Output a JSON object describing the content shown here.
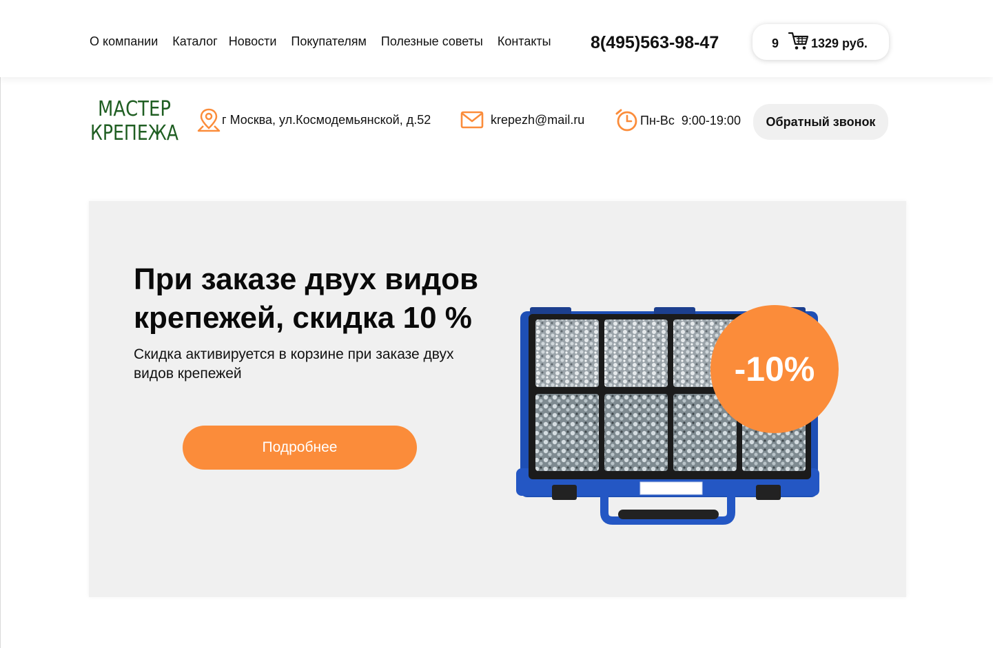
{
  "nav": {
    "items": [
      {
        "label": "О компании"
      },
      {
        "label": "Каталог"
      },
      {
        "label": "Новости"
      },
      {
        "label": "Покупателям"
      },
      {
        "label": "Полезные советы"
      },
      {
        "label": "Контакты"
      }
    ]
  },
  "header": {
    "phone": "8(495)563-98-47",
    "cart": {
      "count": "9",
      "total": "1329 руб."
    }
  },
  "logo": {
    "line1": "МАСТЕР",
    "line2": "КРЕПЕЖА"
  },
  "contacts": {
    "address": "г Москва, ул.Космодемьянской, д.52",
    "email": "krepezh@mail.ru",
    "hours": "Пн-Вс  9:00-19:00",
    "callback_label": "Обратный звонок"
  },
  "promo": {
    "title": "При заказе двух видов крепежей, скидка 10 %",
    "subtitle": "Скидка активируется в корзине при заказе двух видов крепежей",
    "button_label": "Подробнее",
    "badge": "-10%"
  },
  "colors": {
    "accent": "#fb8c3a",
    "logo_green": "#1f5e22",
    "case_blue": "#1e4fb5"
  },
  "icons": [
    "cart-icon",
    "map-pin-icon",
    "mail-icon",
    "clock-icon"
  ]
}
